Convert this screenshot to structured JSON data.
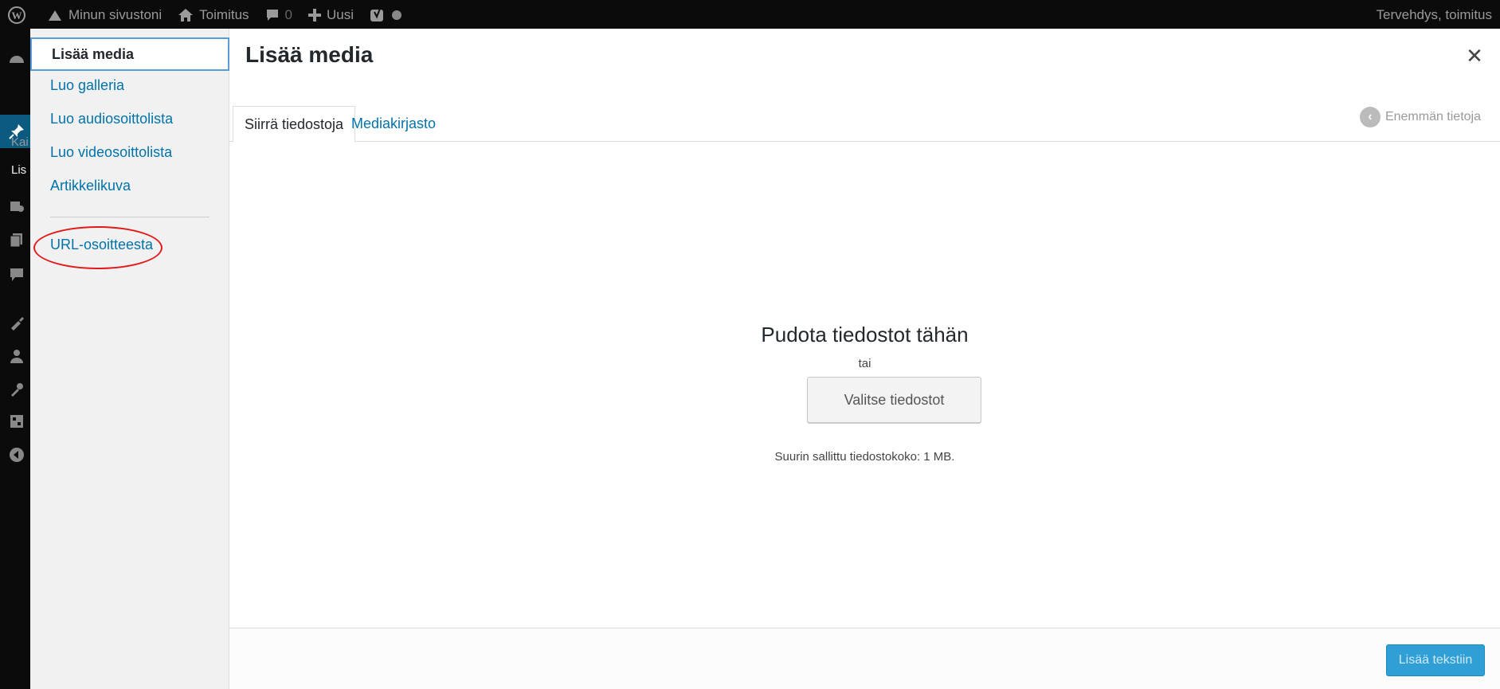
{
  "adminbar": {
    "site_name": "Minun sivustoni",
    "toimitus": "Toimitus",
    "comments_count": "0",
    "new_label": "Uusi",
    "greeting": "Tervehdys, toimitus"
  },
  "leftmenu": {
    "partial_text_1": "Kai",
    "partial_text_2": "Lis"
  },
  "modal": {
    "title": "Lisää media",
    "close_symbol": "✕",
    "menu": {
      "items": [
        {
          "label": "Lisää media"
        },
        {
          "label": "Luo galleria"
        },
        {
          "label": "Luo audiosoittolista"
        },
        {
          "label": "Luo videosoittolista"
        },
        {
          "label": "Artikkelikuva"
        },
        {
          "label": "URL-osoitteesta"
        }
      ]
    },
    "tabs": [
      {
        "label": "Siirrä tiedostoja"
      },
      {
        "label": "Mediakirjasto"
      }
    ],
    "more_info": "Enemmän tietoja",
    "uploader": {
      "drop_title": "Pudota tiedostot tähän",
      "or": "tai",
      "select_button": "Valitse tiedostot",
      "max_size": "Suurin sallittu tiedostokoko: 1 MB."
    },
    "insert_button": "Lisää tekstiin"
  }
}
